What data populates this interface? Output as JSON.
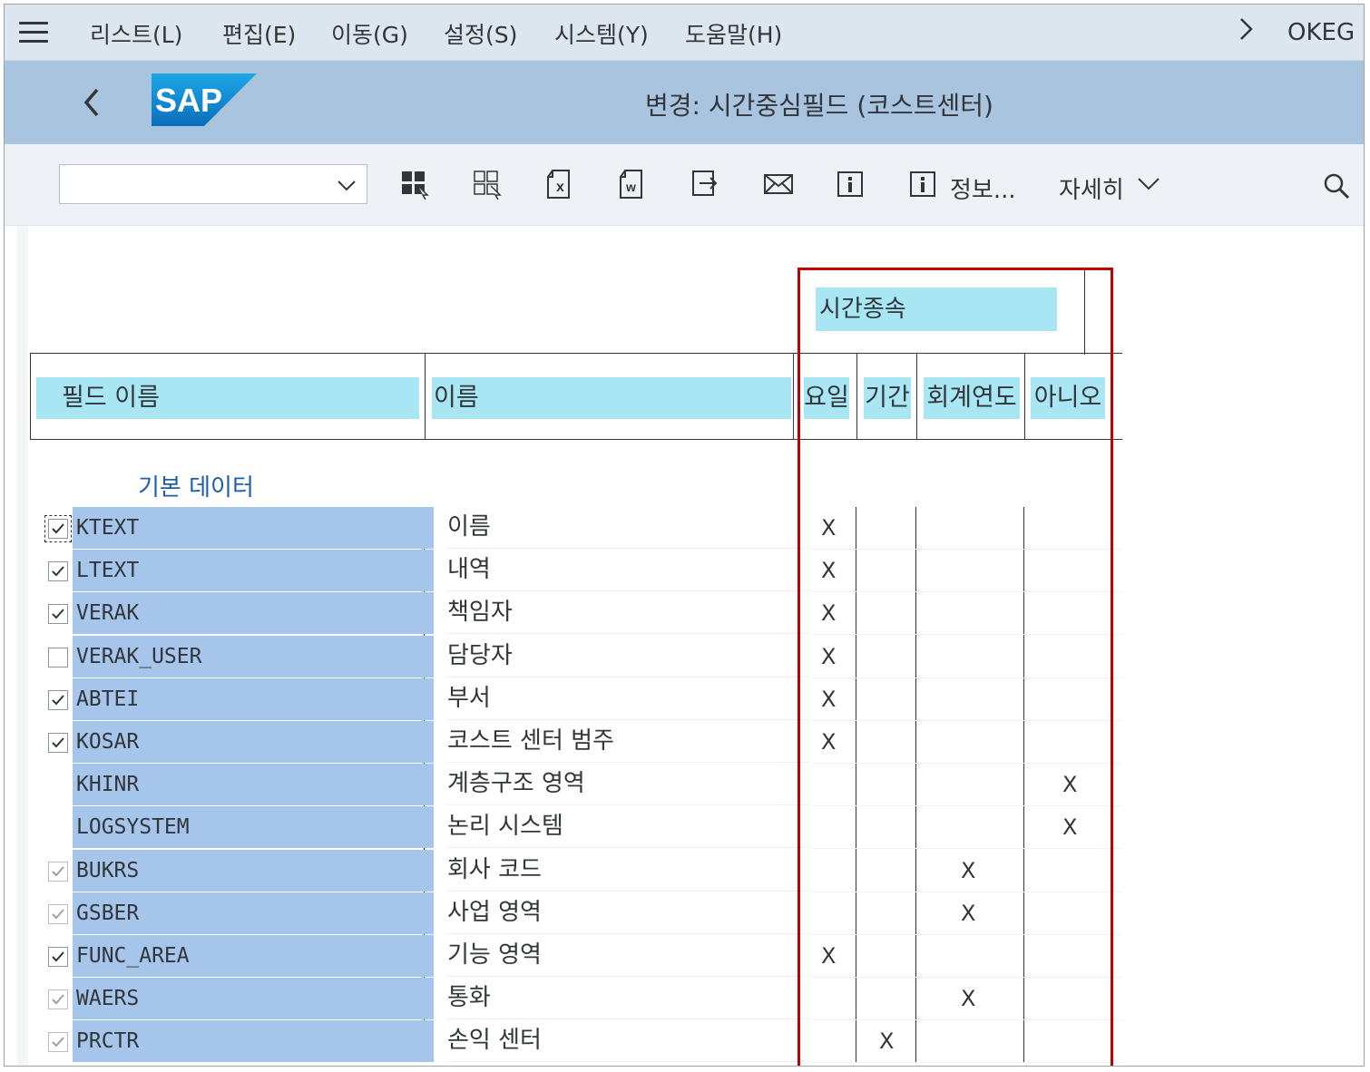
{
  "menubar": {
    "items": [
      "리스트(L)",
      "편집(E)",
      "이동(G)",
      "설정(S)",
      "시스템(Y)",
      "도움말(H)"
    ],
    "transaction_code": "OKEG"
  },
  "titlebar": {
    "logo_text": "SAP",
    "title": "변경: 시간중심필드 (코스트센터)"
  },
  "toolbar": {
    "combo_value": "",
    "info_label": "정보...",
    "more_label": "자세히"
  },
  "table": {
    "group_header": "시간종속",
    "col_field": "필드 이름",
    "col_name": "이름",
    "col_day": "요일",
    "col_period": "기간",
    "col_fiscal": "회계연도",
    "col_no": "아니오",
    "section": "기본 데이터",
    "rows": [
      {
        "field": "KTEXT",
        "name": "이름",
        "checkbox": "checked",
        "day": "X",
        "period": "",
        "fiscal": "",
        "no": ""
      },
      {
        "field": "LTEXT",
        "name": "내역",
        "checkbox": "checked",
        "day": "X",
        "period": "",
        "fiscal": "",
        "no": ""
      },
      {
        "field": "VERAK",
        "name": "책임자",
        "checkbox": "checked",
        "day": "X",
        "period": "",
        "fiscal": "",
        "no": ""
      },
      {
        "field": "VERAK_USER",
        "name": "담당자",
        "checkbox": "unchecked",
        "day": "X",
        "period": "",
        "fiscal": "",
        "no": ""
      },
      {
        "field": "ABTEI",
        "name": "부서",
        "checkbox": "checked",
        "day": "X",
        "period": "",
        "fiscal": "",
        "no": ""
      },
      {
        "field": "KOSAR",
        "name": "코스트 센터 범주",
        "checkbox": "checked",
        "day": "X",
        "period": "",
        "fiscal": "",
        "no": ""
      },
      {
        "field": "KHINR",
        "name": "계층구조 영역",
        "checkbox": "none",
        "day": "",
        "period": "",
        "fiscal": "",
        "no": "X"
      },
      {
        "field": "LOGSYSTEM",
        "name": "논리 시스템",
        "checkbox": "none",
        "day": "",
        "period": "",
        "fiscal": "",
        "no": "X"
      },
      {
        "field": "BUKRS",
        "name": "회사 코드",
        "checkbox": "disabled",
        "day": "",
        "period": "",
        "fiscal": "X",
        "no": ""
      },
      {
        "field": "GSBER",
        "name": "사업 영역",
        "checkbox": "disabled",
        "day": "",
        "period": "",
        "fiscal": "X",
        "no": ""
      },
      {
        "field": "FUNC_AREA",
        "name": "기능 영역",
        "checkbox": "checked",
        "day": "X",
        "period": "",
        "fiscal": "",
        "no": ""
      },
      {
        "field": "WAERS",
        "name": "통화",
        "checkbox": "disabled",
        "day": "",
        "period": "",
        "fiscal": "X",
        "no": ""
      },
      {
        "field": "PRCTR",
        "name": "손익 센터",
        "checkbox": "disabled",
        "day": "",
        "period": "X",
        "fiscal": "",
        "no": ""
      }
    ]
  },
  "colors": {
    "menubar_bg": "#dde6ef",
    "titlebar_bg": "#a9c4de",
    "header_cell_bg": "#a9e6f3",
    "field_cell_bg": "#a6c5ea",
    "highlight_box": "#c00000",
    "section_label": "#1f5ea8"
  }
}
